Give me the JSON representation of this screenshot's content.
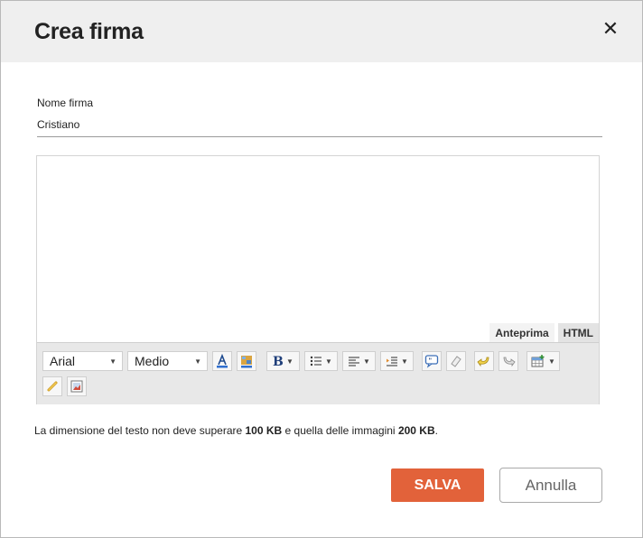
{
  "dialog": {
    "title": "Crea firma",
    "close_glyph": "✕"
  },
  "form": {
    "name_label": "Nome firma",
    "name_value": "Cristiano"
  },
  "editor": {
    "tabs": [
      "Anteprima",
      "HTML"
    ],
    "active_tab": "Anteprima",
    "font_family": "Arial",
    "font_size": "Medio",
    "toolbar_icons": [
      "text-color-icon",
      "background-color-icon",
      "bold-icon",
      "bullet-list-icon",
      "align-left-icon",
      "indent-icon",
      "quote-icon",
      "eraser-icon",
      "undo-icon",
      "redo-icon",
      "table-icon",
      "link-icon",
      "image-icon"
    ]
  },
  "note": {
    "prefix": "La dimensione del testo non deve superare ",
    "text_limit": "100 KB",
    "middle": " e quella delle immagini ",
    "image_limit": "200 KB",
    "suffix": "."
  },
  "buttons": {
    "save": "SALVA",
    "cancel": "Annulla"
  },
  "colors": {
    "header_bg": "#efefef",
    "accent": "#e2623a",
    "toolbar_bg": "#e8e8e8"
  }
}
